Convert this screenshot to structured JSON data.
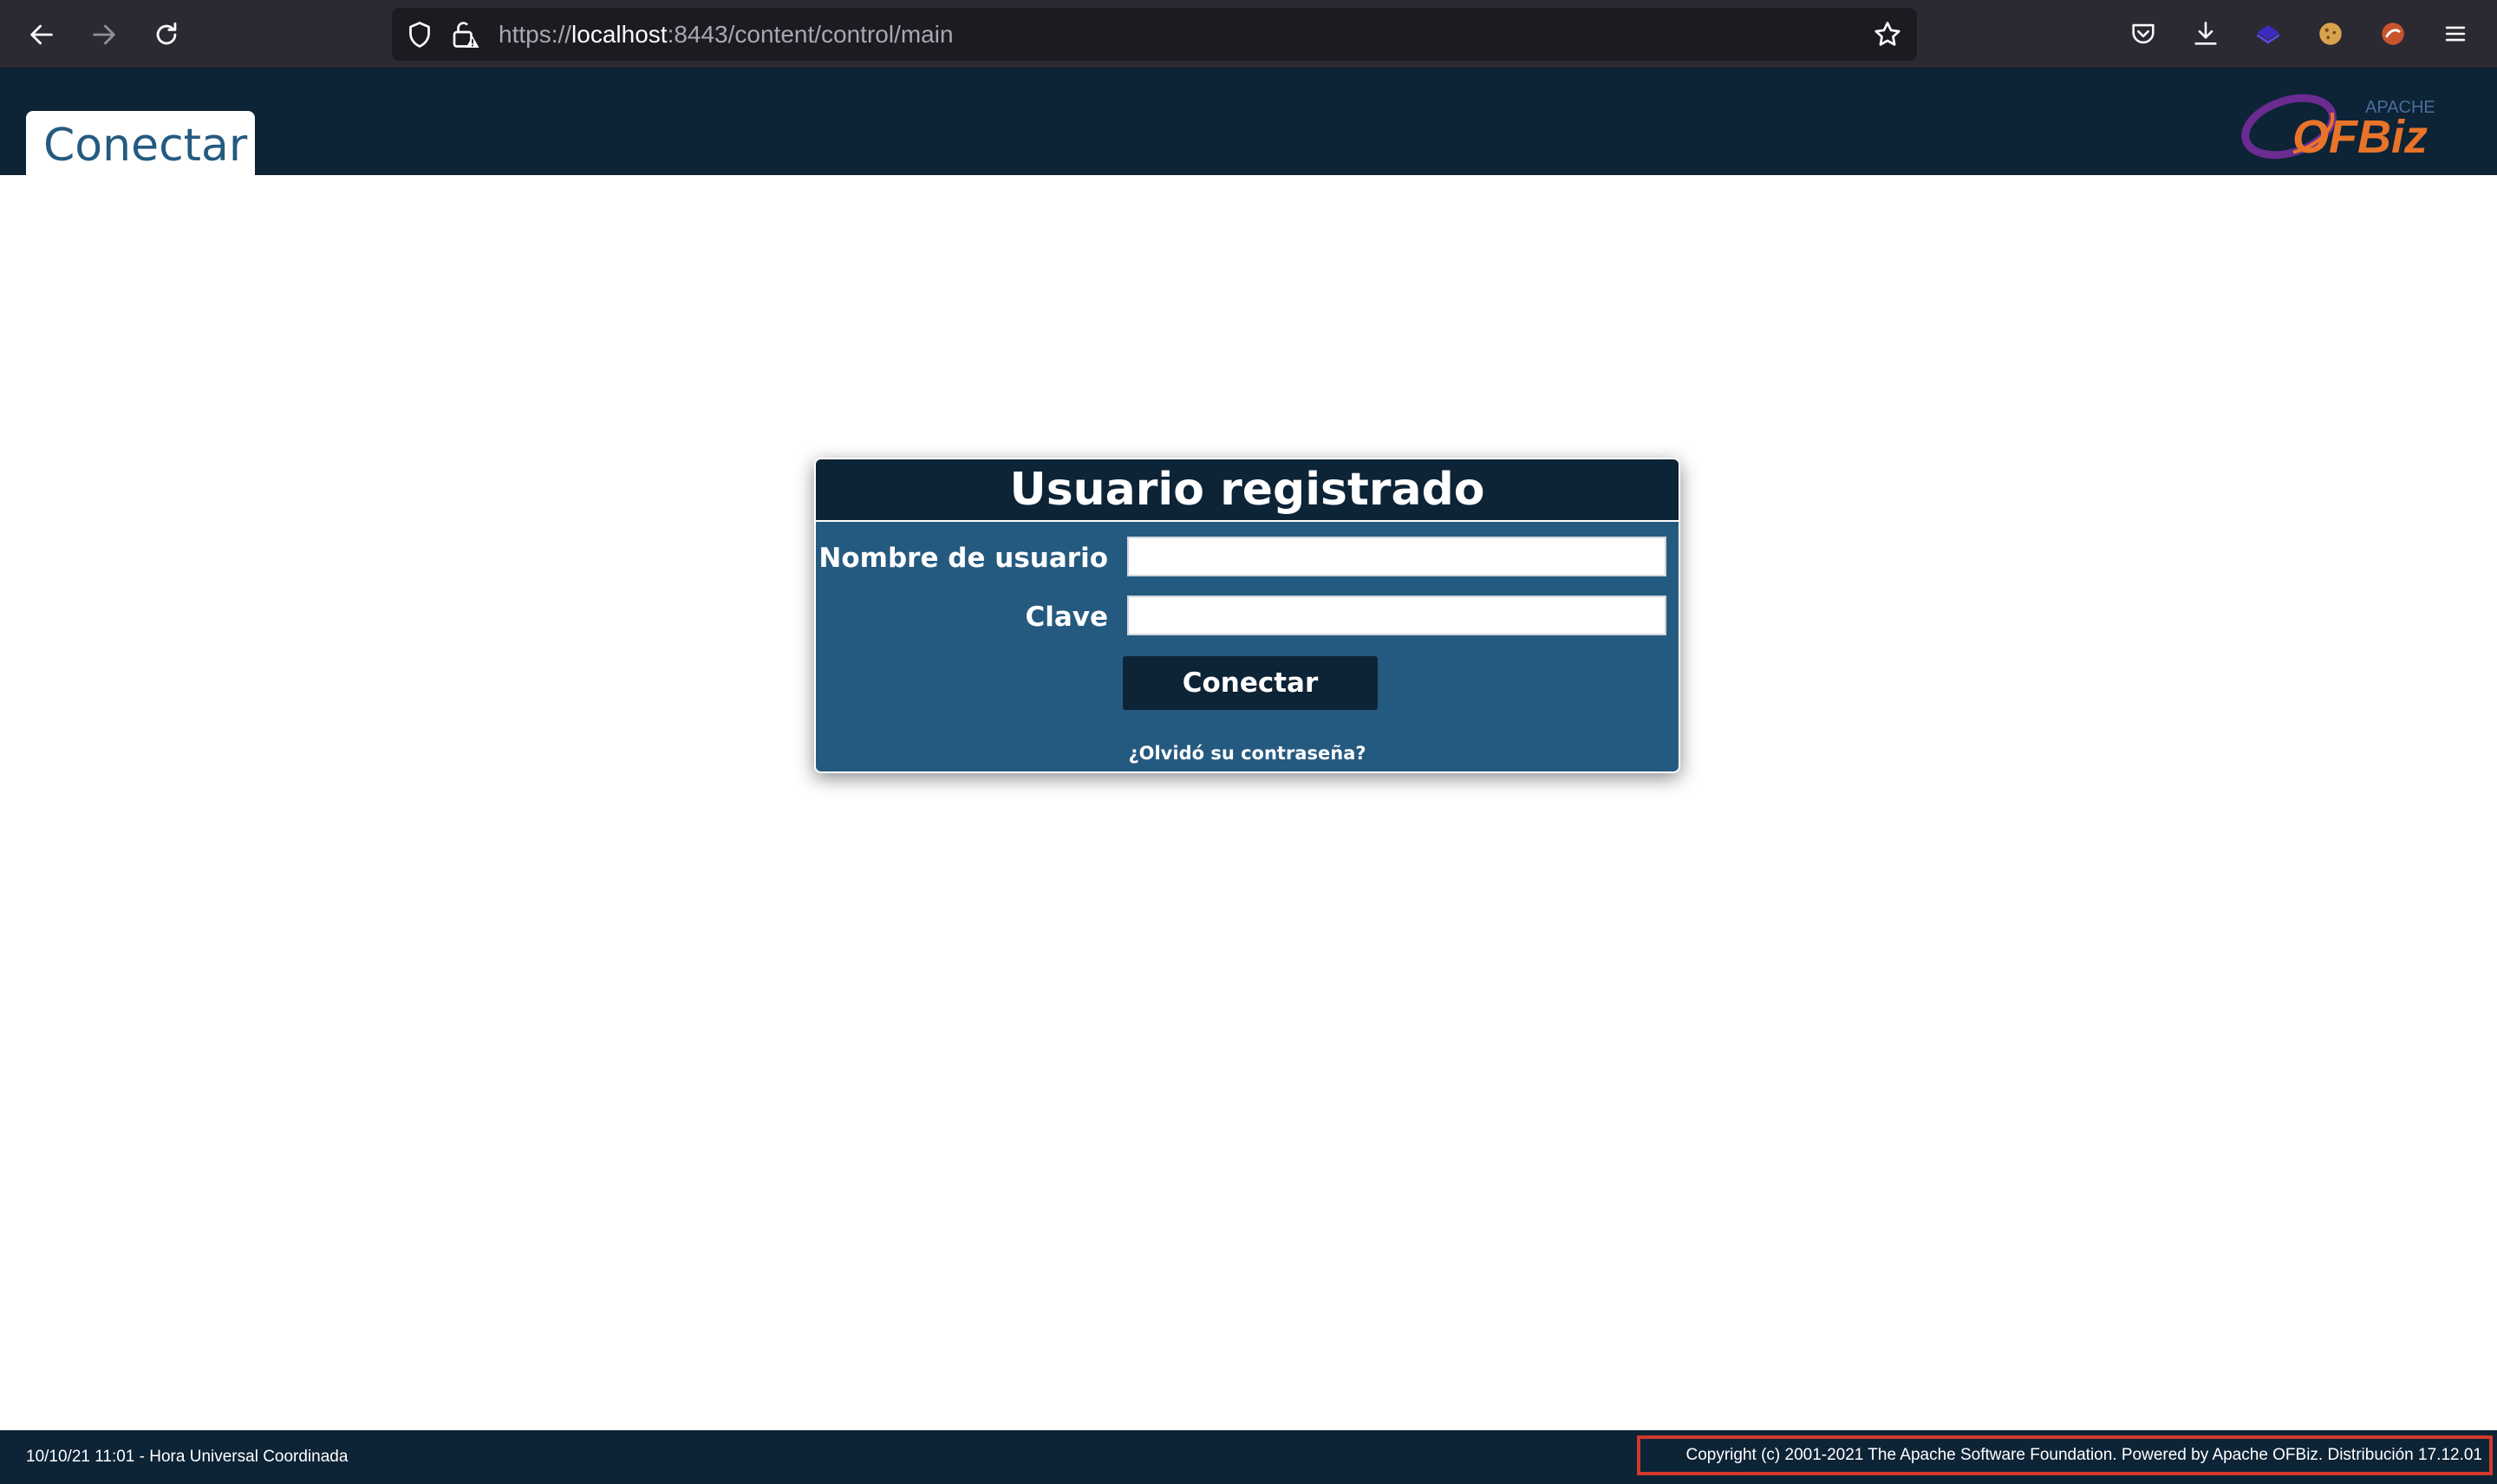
{
  "browser": {
    "url_prefix": "https://",
    "url_host": "localhost",
    "url_rest": ":8443/content/control/main"
  },
  "header": {
    "tab_title": "Conectar",
    "logo_small": "APACHE",
    "logo_text": "OFBiz"
  },
  "login": {
    "title": "Usuario registrado",
    "username_label": "Nombre de usuario",
    "username_value": "",
    "password_label": "Clave",
    "password_value": "",
    "submit_label": "Conectar",
    "forgot_link": "¿Olvidó su contraseña?"
  },
  "footer": {
    "datetime": "10/10/21 11:01 - Hora Universal Coordinada",
    "copyright": "Copyright (c) 2001-2021 The Apache Software Foundation. Powered by Apache OFBiz. Distribución 17.12.01"
  },
  "colors": {
    "header_bg": "#0d2336",
    "login_body": "#255a80",
    "highlight_border": "#d2382b"
  }
}
